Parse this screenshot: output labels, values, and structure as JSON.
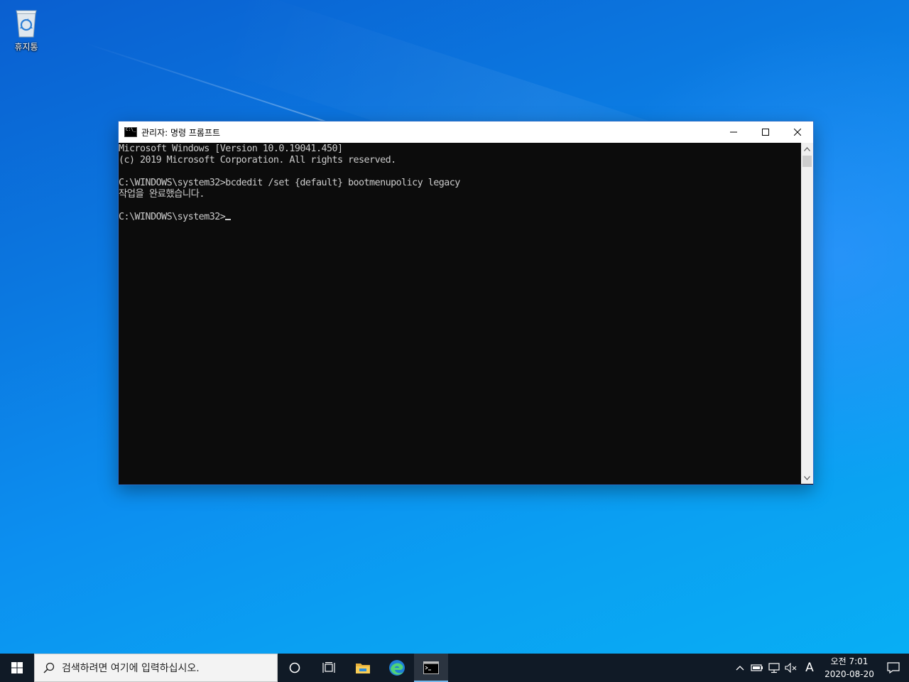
{
  "desktop": {
    "icons": [
      {
        "label": "휴지통",
        "icon": "recycle-bin-icon"
      }
    ]
  },
  "window": {
    "title": "관리자: 명령 프롬프트",
    "icon": "command-prompt-icon",
    "controls": {
      "minimize": "minimize-icon",
      "maximize": "maximize-icon",
      "close": "close-icon"
    },
    "console_lines": [
      "Microsoft Windows [Version 10.0.19041.450]",
      "(c) 2019 Microsoft Corporation. All rights reserved.",
      "",
      "C:\\WINDOWS\\system32>bcdedit /set {default} bootmenupolicy legacy",
      "작업을 완료했습니다.",
      "",
      "C:\\WINDOWS\\system32>"
    ]
  },
  "taskbar": {
    "search_placeholder": "검색하려면 여기에 입력하십시오.",
    "pinned": [
      {
        "name": "cortana",
        "icon": "circle-icon"
      },
      {
        "name": "task-view",
        "icon": "task-view-icon"
      },
      {
        "name": "file-explorer",
        "icon": "folder-icon"
      },
      {
        "name": "edge",
        "icon": "edge-icon"
      },
      {
        "name": "command-prompt",
        "icon": "command-prompt-icon",
        "active": true
      }
    ],
    "tray": {
      "ime_indicator": "A",
      "clock_time": "오전 7:01",
      "clock_date": "2020-08-20"
    }
  },
  "colors": {
    "accent": "#76b9ed",
    "console_bg": "#0c0c0c",
    "console_text": "#cccccc",
    "taskbar_bg": "#101a26"
  }
}
